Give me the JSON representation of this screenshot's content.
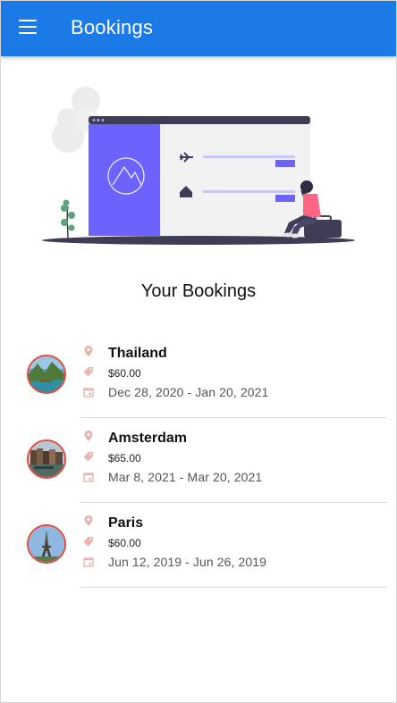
{
  "appbar": {
    "title": "Bookings",
    "color": "#1b7ae6",
    "menu_icon": "menu-icon"
  },
  "hero": {
    "illustration": "travel-booking-illustration",
    "accent": "#6c63ff"
  },
  "section": {
    "title": "Your Bookings"
  },
  "bookings": [
    {
      "destination": "Thailand",
      "price": "$60.00",
      "dates": "Dec 28, 2020 - Jan 20, 2021",
      "image": "thailand-thumbnail"
    },
    {
      "destination": "Amsterdam",
      "price": "$65.00",
      "dates": "Mar 8, 2021 - Mar 20, 2021",
      "image": "amsterdam-thumbnail"
    },
    {
      "destination": "Paris",
      "price": "$60.00",
      "dates": "Jun 12, 2019 - Jun 26, 2019",
      "image": "paris-thumbnail"
    }
  ],
  "icons": {
    "location": "map-pin-icon",
    "price": "price-tag-icon",
    "date": "calendar-icon"
  },
  "colors": {
    "avatar_border": "#e24b3b",
    "icon_tint": "#e8b4ac"
  }
}
